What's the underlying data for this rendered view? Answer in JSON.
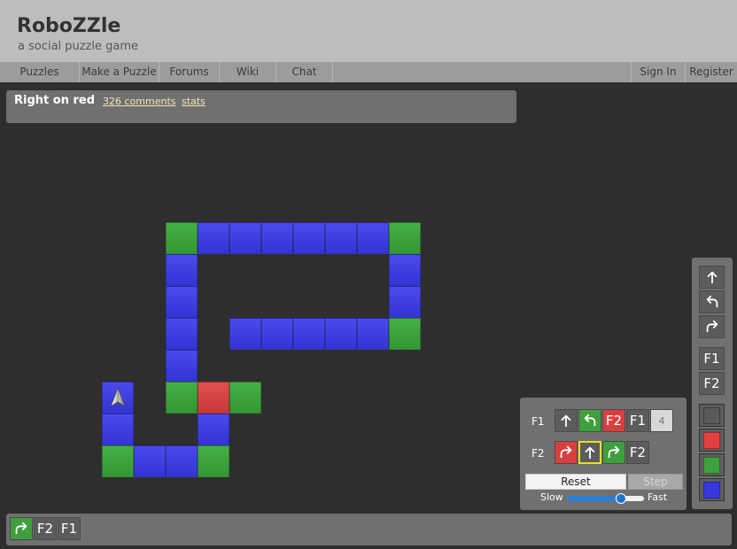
{
  "site": {
    "title": "RoboZZle",
    "tagline": "a social puzzle game"
  },
  "nav": {
    "items": [
      {
        "label": "Puzzles",
        "name": "nav-puzzles"
      },
      {
        "label": "Make a Puzzle",
        "name": "nav-make-a-puzzle"
      },
      {
        "label": "Forums",
        "name": "nav-forums"
      },
      {
        "label": "Wiki",
        "name": "nav-wiki"
      },
      {
        "label": "Chat",
        "name": "nav-chat"
      }
    ],
    "right_items": [
      {
        "label": "Sign In",
        "name": "nav-sign-in"
      },
      {
        "label": "Register",
        "name": "nav-register"
      }
    ]
  },
  "puzzle": {
    "title": "Right on red",
    "comments_link": "326 comments",
    "stats_link": "stats"
  },
  "board": {
    "robot": {
      "row": 9,
      "col": 3,
      "facing": "up",
      "icon": "robot-arrow-icon"
    },
    "tiles": [
      {
        "row": 5,
        "col": 5,
        "color": "green"
      },
      {
        "row": 5,
        "col": 6,
        "color": "blue"
      },
      {
        "row": 5,
        "col": 7,
        "color": "blue"
      },
      {
        "row": 5,
        "col": 8,
        "color": "blue"
      },
      {
        "row": 5,
        "col": 9,
        "color": "blue"
      },
      {
        "row": 5,
        "col": 10,
        "color": "blue"
      },
      {
        "row": 5,
        "col": 11,
        "color": "blue"
      },
      {
        "row": 5,
        "col": 12,
        "color": "green"
      },
      {
        "row": 6,
        "col": 5,
        "color": "blue"
      },
      {
        "row": 6,
        "col": 12,
        "color": "blue"
      },
      {
        "row": 7,
        "col": 5,
        "color": "blue"
      },
      {
        "row": 7,
        "col": 12,
        "color": "blue"
      },
      {
        "row": 8,
        "col": 5,
        "color": "blue"
      },
      {
        "row": 8,
        "col": 7,
        "color": "blue"
      },
      {
        "row": 8,
        "col": 8,
        "color": "blue"
      },
      {
        "row": 8,
        "col": 9,
        "color": "blue"
      },
      {
        "row": 8,
        "col": 10,
        "color": "blue"
      },
      {
        "row": 8,
        "col": 11,
        "color": "blue"
      },
      {
        "row": 8,
        "col": 12,
        "color": "green"
      },
      {
        "row": 9,
        "col": 5,
        "color": "blue"
      },
      {
        "row": 10,
        "col": 3,
        "color": "blue"
      },
      {
        "row": 10,
        "col": 5,
        "color": "green"
      },
      {
        "row": 10,
        "col": 6,
        "color": "red"
      },
      {
        "row": 10,
        "col": 7,
        "color": "green"
      },
      {
        "row": 11,
        "col": 3,
        "color": "blue"
      },
      {
        "row": 11,
        "col": 6,
        "color": "blue"
      },
      {
        "row": 12,
        "col": 3,
        "color": "green"
      },
      {
        "row": 12,
        "col": 4,
        "color": "blue"
      },
      {
        "row": 12,
        "col": 5,
        "color": "blue"
      },
      {
        "row": 12,
        "col": 6,
        "color": "green"
      }
    ]
  },
  "program": {
    "functions": [
      {
        "label": "F1",
        "slots": [
          {
            "cmd": "forward",
            "color": "gray",
            "text": ""
          },
          {
            "cmd": "left",
            "color": "green",
            "text": ""
          },
          {
            "cmd": "call",
            "color": "red",
            "text": "F2"
          },
          {
            "cmd": "call",
            "color": "gray",
            "text": "F1"
          },
          {
            "cmd": "empty",
            "color": "empty",
            "text": "4"
          }
        ]
      },
      {
        "label": "F2",
        "slots": [
          {
            "cmd": "right",
            "color": "red",
            "text": ""
          },
          {
            "cmd": "forward",
            "color": "gray",
            "text": "",
            "selected": true
          },
          {
            "cmd": "right",
            "color": "green",
            "text": ""
          },
          {
            "cmd": "call",
            "color": "gray",
            "text": "F2"
          }
        ]
      }
    ],
    "reset_label": "Reset",
    "step_label": "Step",
    "speed": {
      "slow_label": "Slow",
      "fast_label": "Fast",
      "value": 0.7
    }
  },
  "toolbox": {
    "commands": [
      {
        "cmd": "forward",
        "text": "",
        "name": "tool-forward"
      },
      {
        "cmd": "left",
        "text": "",
        "name": "tool-turn-left"
      },
      {
        "cmd": "right",
        "text": "",
        "name": "tool-turn-right"
      },
      {
        "cmd": "call",
        "text": "F1",
        "name": "tool-call-f1"
      },
      {
        "cmd": "call",
        "text": "F2",
        "name": "tool-call-f2"
      }
    ],
    "colors": [
      {
        "color": "#5a5a5a",
        "name": "color-gray-swatch"
      },
      {
        "color": "#e04040",
        "name": "color-red-swatch"
      },
      {
        "color": "#3fa03f",
        "name": "color-green-swatch"
      },
      {
        "color": "#3838e0",
        "name": "color-blue-swatch"
      }
    ]
  },
  "stack": [
    {
      "cmd": "right",
      "color": "green",
      "text": ""
    },
    {
      "cmd": "call",
      "color": "gray",
      "text": "F2"
    },
    {
      "cmd": "call",
      "color": "gray",
      "text": "F1"
    }
  ],
  "colors": {
    "tile_blue": "#3e3ee0",
    "tile_green": "#3fa03f",
    "tile_red": "#d84444",
    "panel": "#707070",
    "background": "#2e2e2e",
    "link": "#f0e6b4"
  }
}
